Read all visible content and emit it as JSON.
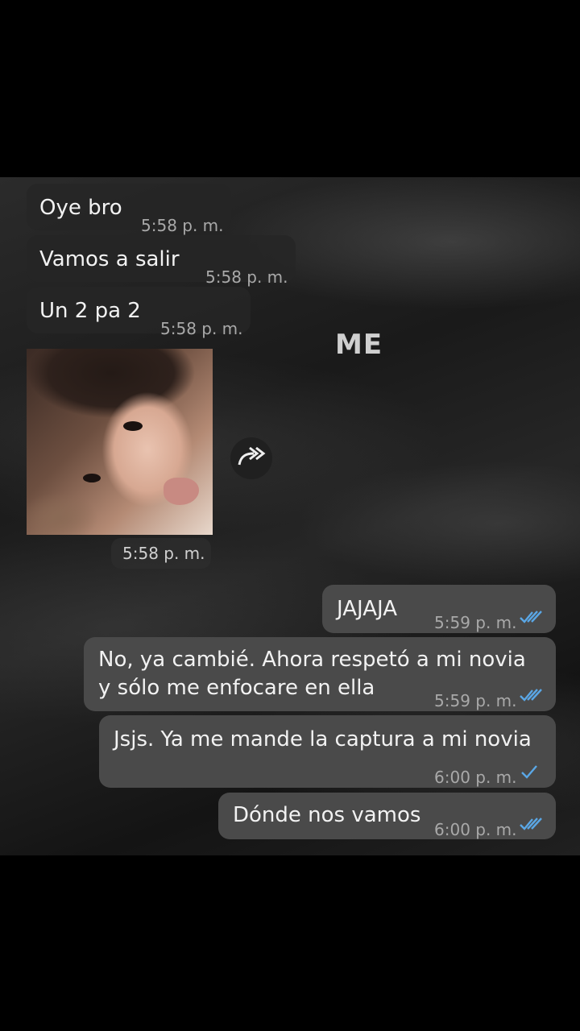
{
  "watermark": "ME",
  "messages": [
    {
      "direction": "incoming",
      "text": "Oye bro",
      "time": "5:58 p. m."
    },
    {
      "direction": "incoming",
      "text": "Vamos a salir",
      "time": "5:58 p. m."
    },
    {
      "direction": "incoming",
      "text": "Un 2 pa 2",
      "time": "5:58 p. m."
    },
    {
      "direction": "incoming",
      "type": "image",
      "time": "5:58 p. m."
    },
    {
      "direction": "outgoing",
      "text": "JAJAJA",
      "time": "5:59 p. m.",
      "status": "read"
    },
    {
      "direction": "outgoing",
      "text_line1": "No, ya cambié. Ahora respetó a mi novia",
      "text_line2": "y sólo me enfocare en ella",
      "time": "5:59 p. m.",
      "status": "read"
    },
    {
      "direction": "outgoing",
      "text": "Jsjs. Ya me mande la captura a mi novia",
      "time": "6:00 p. m.",
      "status": "sent"
    },
    {
      "direction": "outgoing",
      "text": "Dónde nos vamos",
      "time": "6:00 p. m.",
      "status": "read"
    }
  ],
  "icons": {
    "forward": "forward-icon",
    "read": "double-check-icon",
    "sent": "single-check-icon"
  },
  "colors": {
    "read_ticks": "#5aa7e6",
    "bubble_out": "#4a4a4a",
    "bubble_in": "#262626"
  }
}
